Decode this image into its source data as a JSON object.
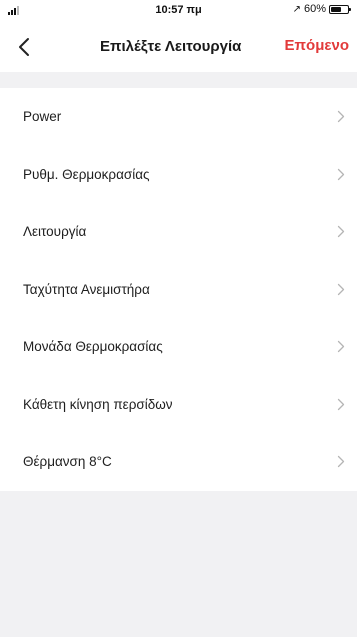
{
  "status_bar": {
    "time": "10:57 πμ",
    "battery": "60%",
    "battery_level": 0.6,
    "icons": [
      "signal-icon",
      "location-icon",
      "battery-icon"
    ]
  },
  "nav": {
    "back_icon": "chevron-left-icon",
    "title": "Επιλέξτε Λειτουργία",
    "next_label": "Επόμενο",
    "accent_color": "#e23a3a"
  },
  "functions": [
    {
      "label": "Power"
    },
    {
      "label": "Ρυθμ. Θερμοκρασίας"
    },
    {
      "label": "Λειτουργία"
    },
    {
      "label": "Ταχύτητα Ανεμιστήρα"
    },
    {
      "label": "Μονάδα Θερμοκρασίας"
    },
    {
      "label": "Κάθετη κίνηση περσίδων"
    },
    {
      "label": "Θέρμανση 8°C"
    }
  ]
}
